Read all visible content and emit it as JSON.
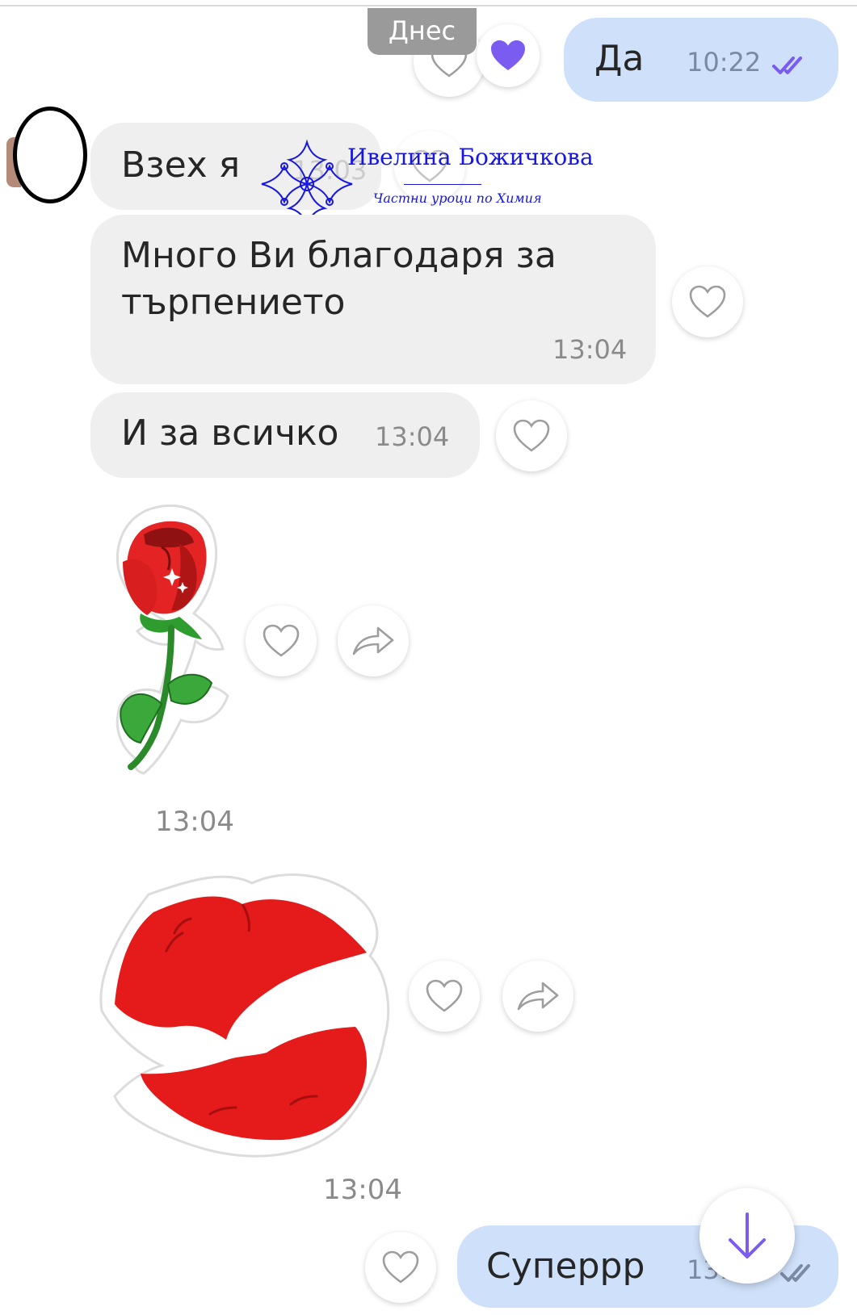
{
  "chat": {
    "date_label": "Днес",
    "messages": [
      {
        "id": "m1",
        "direction": "out",
        "text": "Да",
        "time": "10:22",
        "status": "read",
        "liked": true
      },
      {
        "id": "m2",
        "direction": "in",
        "text": "Взех я",
        "time": "13:03"
      },
      {
        "id": "m3",
        "direction": "in",
        "text_line1": "Много Ви благодаря за",
        "text_line2": "търпението",
        "time": "13:04"
      },
      {
        "id": "m4",
        "direction": "in",
        "text": "И за всичко",
        "time": "13:04"
      },
      {
        "id": "m5",
        "direction": "in",
        "sticker": "rose-sticker",
        "time": "13:04"
      },
      {
        "id": "m6",
        "direction": "in",
        "sticker": "lips-kiss-sticker",
        "time": "13:04"
      },
      {
        "id": "m7",
        "direction": "out",
        "text": "Суперрр",
        "time": "13:",
        "status": "read"
      }
    ]
  },
  "watermark": {
    "name": "Ивелина Божичкова",
    "subtitle": "Частни уроци по Химия",
    "color": "#1717e0"
  },
  "colors": {
    "incoming_bubble": "#efefef",
    "outgoing_bubble": "#cfe1fa",
    "accent": "#7b5cf0",
    "heart_liked": "#7b5cf0"
  }
}
